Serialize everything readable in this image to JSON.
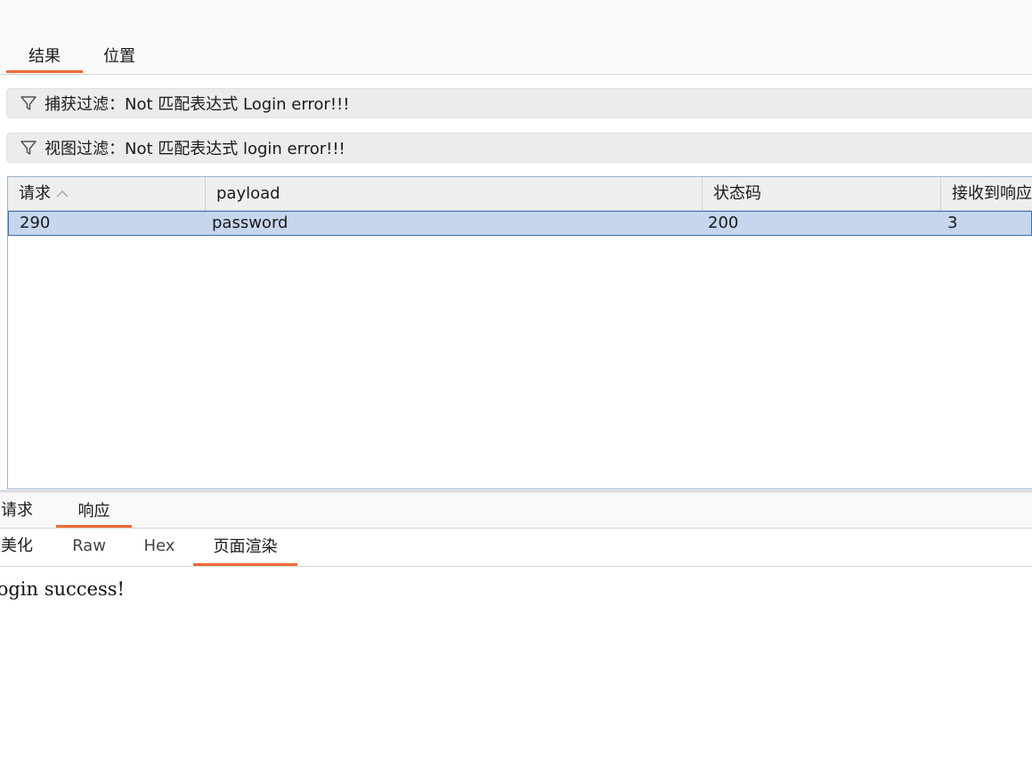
{
  "top_tabs": [
    {
      "label": "结果",
      "active": true
    },
    {
      "label": "位置",
      "active": false
    }
  ],
  "filters": {
    "capture": {
      "text": "捕获过滤：Not 匹配表达式 Login error!!!",
      "icon": "filter-icon"
    },
    "view": {
      "text": "视图过滤：Not 匹配表达式 login error!!!",
      "icon": "filter-icon"
    }
  },
  "table": {
    "columns": [
      "请求",
      "payload",
      "状态码",
      "接收到响应"
    ],
    "sort_column": "请求",
    "sort_direction": "ascending",
    "rows": [
      {
        "request": "290",
        "payload": "password",
        "status": "200",
        "received": "3"
      }
    ]
  },
  "message_tabs": [
    {
      "label": "请求",
      "active": false
    },
    {
      "label": "响应",
      "active": true
    }
  ],
  "view_tabs": [
    {
      "label": "美化",
      "active": false
    },
    {
      "label": "Raw",
      "active": false
    },
    {
      "label": "Hex",
      "active": false
    },
    {
      "label": "页面渲染",
      "active": true
    }
  ],
  "render": {
    "text": "login success!"
  },
  "colors": {
    "accent": "#f06a35",
    "selection": "#c6d6ee",
    "selection_border": "#3a6fb5"
  }
}
